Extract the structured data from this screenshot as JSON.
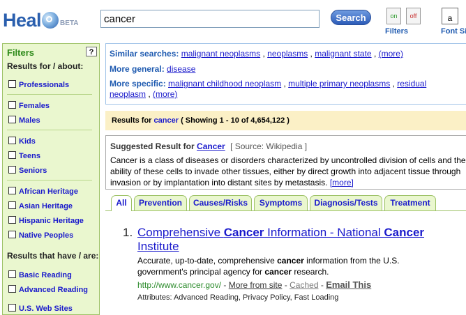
{
  "header": {
    "logo_prefix": "Heal",
    "logo_badge": "BETA",
    "search_value": "cancer",
    "search_button": "Search",
    "filter_on": "on",
    "filter_off": "off",
    "filters_label": "Filters",
    "font_glyph": "a",
    "font_label": "Font Si"
  },
  "sidebar": {
    "title": "Filters",
    "help": "?",
    "about_heading": "Results for / about:",
    "about_items": [
      "Professionals",
      "Females",
      "Males",
      "Kids",
      "Teens",
      "Seniors",
      "African Heritage",
      "Asian Heritage",
      "Hispanic Heritage",
      "Native Peoples"
    ],
    "have_heading": "Results that have / are:",
    "have_items": [
      "Basic Reading",
      "Advanced Reading",
      "U.S. Web Sites"
    ]
  },
  "related": {
    "similar_label": "Similar searches:",
    "similar_links": [
      "malignant neoplasms",
      "neoplasms",
      "malignant state"
    ],
    "more": "(more)",
    "general_label": "More general:",
    "general_link": "disease",
    "specific_label": "More specific:",
    "specific_links": [
      "malignant childhood neoplasm",
      "multiple primary neoplasms",
      "residual",
      "neoplasm"
    ]
  },
  "results_bar": {
    "prefix": "Results for",
    "query": "cancer",
    "showing": "( Showing 1 - 10 of 4,654,122 )"
  },
  "suggested": {
    "label": "Suggested Result for",
    "query": "Cancer",
    "source": "[ Source: Wikipedia ]",
    "body": "Cancer is a class of diseases or disorders characterized by uncontrolled division of cells and the ability of these cells to invade other tissues, either by direct growth into adjacent tissue through invasion or by implantation into distant sites by metastasis.",
    "more": "[more]"
  },
  "tabs": [
    "All",
    "Prevention",
    "Causes/Risks",
    "Symptoms",
    "Diagnosis/Tests",
    "Treatment"
  ],
  "result": {
    "number": "1.",
    "title_parts": [
      "Comprehensive ",
      "Cancer",
      " Information - National ",
      "Cancer",
      " Institute"
    ],
    "snippet_parts": [
      "Accurate, up-to-date, comprehensive ",
      "cancer",
      " information from the U.S. government's principal agency for ",
      "cancer",
      " research."
    ],
    "url": "http://www.cancer.gov/",
    "more_from_site": "More from site",
    "cached": "Cached",
    "email": "Email This",
    "attributes": "Attributes: Advanced Reading, Privacy Policy, Fast Loading"
  },
  "colors": {
    "link": "#1a1acc",
    "sidebar_bg": "#eaf7cf",
    "sidebar_title": "#2e8a1a",
    "results_bar_bg": "#fbf0c6",
    "url_green": "#2a8a2a"
  }
}
